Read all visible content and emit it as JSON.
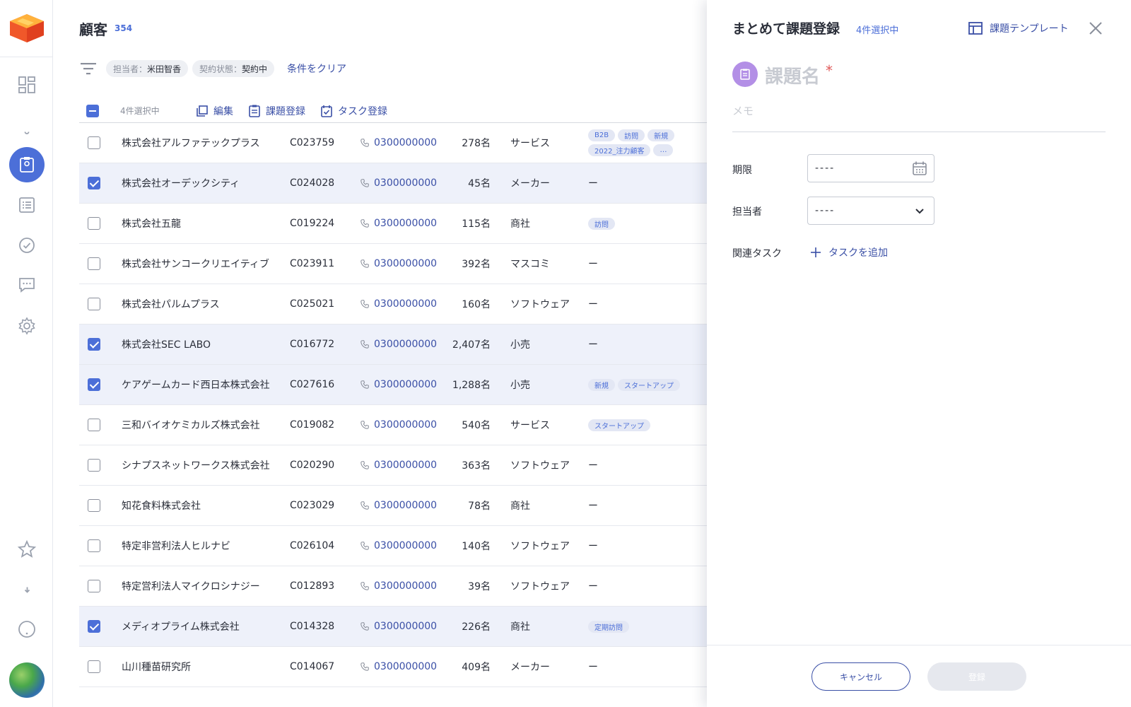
{
  "sidebar": {
    "items": [
      {
        "name": "dashboard-icon",
        "active": false
      },
      {
        "name": "bell-icon",
        "active": false
      },
      {
        "name": "customer-card-icon",
        "active": true
      },
      {
        "name": "list-icon",
        "active": false
      },
      {
        "name": "check-circle-icon",
        "active": false
      },
      {
        "name": "chat-icon",
        "active": false
      },
      {
        "name": "gear-icon",
        "active": false
      }
    ],
    "bottom_items": [
      "star-icon",
      "cloud-download-icon",
      "help-icon"
    ]
  },
  "header": {
    "title": "顧客",
    "count": "354"
  },
  "filters": {
    "chips": [
      {
        "key": "担当者：",
        "value": "米田智香"
      },
      {
        "key": "契約状態：",
        "value": "契約中"
      }
    ],
    "clear_label": "条件をクリア"
  },
  "toolbar": {
    "selected_label": "4件選択中",
    "edit_label": "編集",
    "issue_label": "課題登録",
    "task_label": "タスク登録"
  },
  "rows": [
    {
      "name": "株式会社アルファテックプラス",
      "code": "C023759",
      "phone": "0300000000",
      "employees": "278名",
      "industry": "サービス",
      "tags": [
        "B2B",
        "訪問",
        "新規",
        "2022_注力顧客",
        "…"
      ],
      "selected": false
    },
    {
      "name": "株式会社オーデックシティ",
      "code": "C024028",
      "phone": "0300000000",
      "employees": "45名",
      "industry": "メーカー",
      "tags": [],
      "selected": true
    },
    {
      "name": "株式会社五龍",
      "code": "C019224",
      "phone": "0300000000",
      "employees": "115名",
      "industry": "商社",
      "tags": [
        "訪問"
      ],
      "selected": false
    },
    {
      "name": "株式会社サンコークリエイティブ",
      "code": "C023911",
      "phone": "0300000000",
      "employees": "392名",
      "industry": "マスコミ",
      "tags": [],
      "selected": false
    },
    {
      "name": "株式会社パルムプラス",
      "code": "C025021",
      "phone": "0300000000",
      "employees": "160名",
      "industry": "ソフトウェア",
      "tags": [],
      "selected": false
    },
    {
      "name": "株式会社SEC LABO",
      "code": "C016772",
      "phone": "0300000000",
      "employees": "2,407名",
      "industry": "小売",
      "tags": [],
      "selected": true
    },
    {
      "name": "ケアゲームカード西日本株式会社",
      "code": "C027616",
      "phone": "0300000000",
      "employees": "1,288名",
      "industry": "小売",
      "tags": [
        "新規",
        "スタートアップ"
      ],
      "selected": true
    },
    {
      "name": "三和バイオケミカルズ株式会社",
      "code": "C019082",
      "phone": "0300000000",
      "employees": "540名",
      "industry": "サービス",
      "tags": [
        "スタートアップ"
      ],
      "selected": false
    },
    {
      "name": "シナプスネットワークス株式会社",
      "code": "C020290",
      "phone": "0300000000",
      "employees": "363名",
      "industry": "ソフトウェア",
      "tags": [],
      "selected": false
    },
    {
      "name": "知花食料株式会社",
      "code": "C023029",
      "phone": "0300000000",
      "employees": "78名",
      "industry": "商社",
      "tags": [],
      "selected": false
    },
    {
      "name": "特定非営利法人ヒルナビ",
      "code": "C026104",
      "phone": "0300000000",
      "employees": "140名",
      "industry": "ソフトウェア",
      "tags": [],
      "selected": false
    },
    {
      "name": "特定営利法人マイクロシナジー",
      "code": "C012893",
      "phone": "0300000000",
      "employees": "39名",
      "industry": "ソフトウェア",
      "tags": [],
      "selected": false
    },
    {
      "name": "メディオプライム株式会社",
      "code": "C014328",
      "phone": "0300000000",
      "employees": "226名",
      "industry": "商社",
      "tags": [
        "定期訪問"
      ],
      "selected": true
    },
    {
      "name": "山川種苗研究所",
      "code": "C014067",
      "phone": "0300000000",
      "employees": "409名",
      "industry": "メーカー",
      "tags": [],
      "selected": false
    }
  ],
  "empty_tag_text": "ー",
  "panel": {
    "title": "まとめて課題登録",
    "selected_label": "4件選択中",
    "template_label": "課題テンプレート",
    "name_placeholder": "課題名",
    "required_mark": "*",
    "memo_placeholder": "メモ",
    "deadline_label": "期限",
    "deadline_value": "----",
    "assignee_label": "担当者",
    "assignee_value": "----",
    "related_task_label": "関連タスク",
    "add_task_label": "タスクを追加",
    "cancel_label": "キャンセル",
    "submit_label": "登録"
  }
}
